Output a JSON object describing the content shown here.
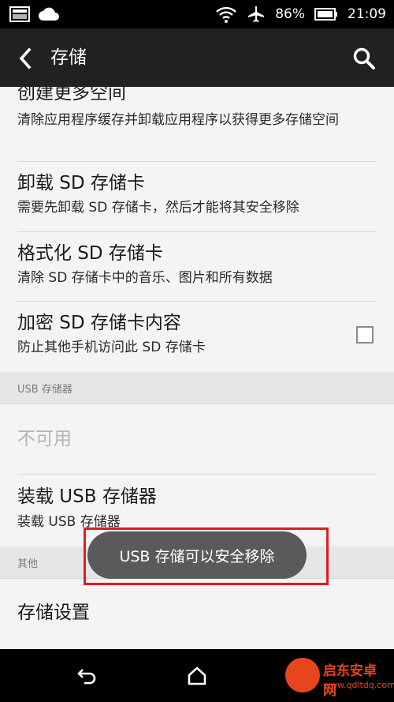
{
  "status_bar": {
    "battery_percent": "86%",
    "time": "21:09"
  },
  "app_bar": {
    "title": "存储"
  },
  "sd_section": {
    "create_space": {
      "title": "创建更多空间",
      "subtitle": "清除应用程序缓存并卸载应用程序以获得更多存储空间"
    },
    "unmount_sd": {
      "title": "卸载 SD 存储卡",
      "subtitle": "需要先卸载 SD 存储卡，然后才能将其安全移除"
    },
    "format_sd": {
      "title": "格式化 SD 存储卡",
      "subtitle": "清除 SD 存储卡中的音乐、图片和所有数据"
    },
    "encrypt_sd": {
      "title": "加密 SD 存储卡内容",
      "subtitle": "防止其他手机访问此 SD 存储卡",
      "checked": false
    }
  },
  "usb_section": {
    "header": "USB 存储器",
    "unavailable": "不可用",
    "mount_usb": {
      "title": "装载 USB 存储器",
      "subtitle": "装载 USB 存储器"
    }
  },
  "other_section": {
    "header": "其他",
    "storage_settings": "存储设置"
  },
  "toast": {
    "message": "USB 存储可以安全移除"
  },
  "watermark": {
    "name": "启东安卓网",
    "url": "www.qdltdq.com"
  },
  "colors": {
    "status_bar": "#000000",
    "app_bar": "#212121",
    "background": "#f4f4f4",
    "section_header": "#e6e6e6",
    "toast": "#5a5a5a",
    "highlight": "#e01b24"
  },
  "icons": [
    "gallery-icon",
    "cloud-icon",
    "wifi-icon",
    "airplane-icon",
    "battery-icon",
    "back-arrow-icon",
    "search-icon",
    "nav-back-icon",
    "nav-home-icon"
  ]
}
